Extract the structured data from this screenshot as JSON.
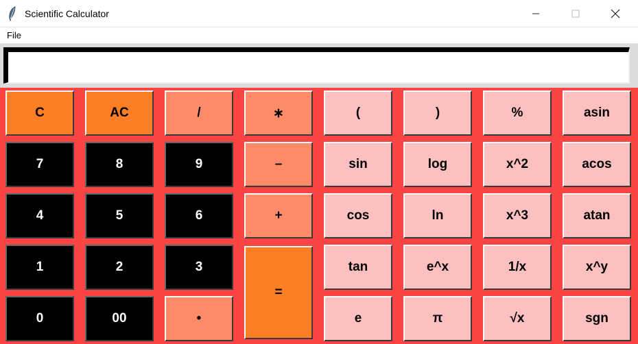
{
  "window": {
    "title": "Scientific Calculator",
    "minimize_icon": "minimize-icon",
    "maximize_icon": "maximize-icon",
    "close_icon": "close-icon",
    "app_icon": "feather-icon"
  },
  "menu": {
    "file_label": "File"
  },
  "display": {
    "value": ""
  },
  "colors": {
    "keypad_bg": "#fc4445",
    "orange": "#fc7e25",
    "salmon": "#fd8b6a",
    "black": "#000000",
    "pink": "#fdc0c0"
  },
  "keys": {
    "c": "C",
    "ac": "AC",
    "div": "/",
    "mul": "∗",
    "lparen": "(",
    "rparen": ")",
    "pct": "%",
    "asin": "asin",
    "n7": "7",
    "n8": "8",
    "n9": "9",
    "minus": "–",
    "sin": "sin",
    "log": "log",
    "x2": "x^2",
    "acos": "acos",
    "n4": "4",
    "n5": "5",
    "n6": "6",
    "plus": "+",
    "cos": "cos",
    "ln": "ln",
    "x3": "x^3",
    "atan": "atan",
    "n1": "1",
    "n2": "2",
    "n3": "3",
    "eq": "=",
    "tan": "tan",
    "ex": "e^x",
    "inv": "1/x",
    "xy": "x^y",
    "n0": "0",
    "n00": "00",
    "dot": "•",
    "e": "e",
    "pi": "π",
    "sqrt": "√x",
    "sgn": "sgn"
  }
}
